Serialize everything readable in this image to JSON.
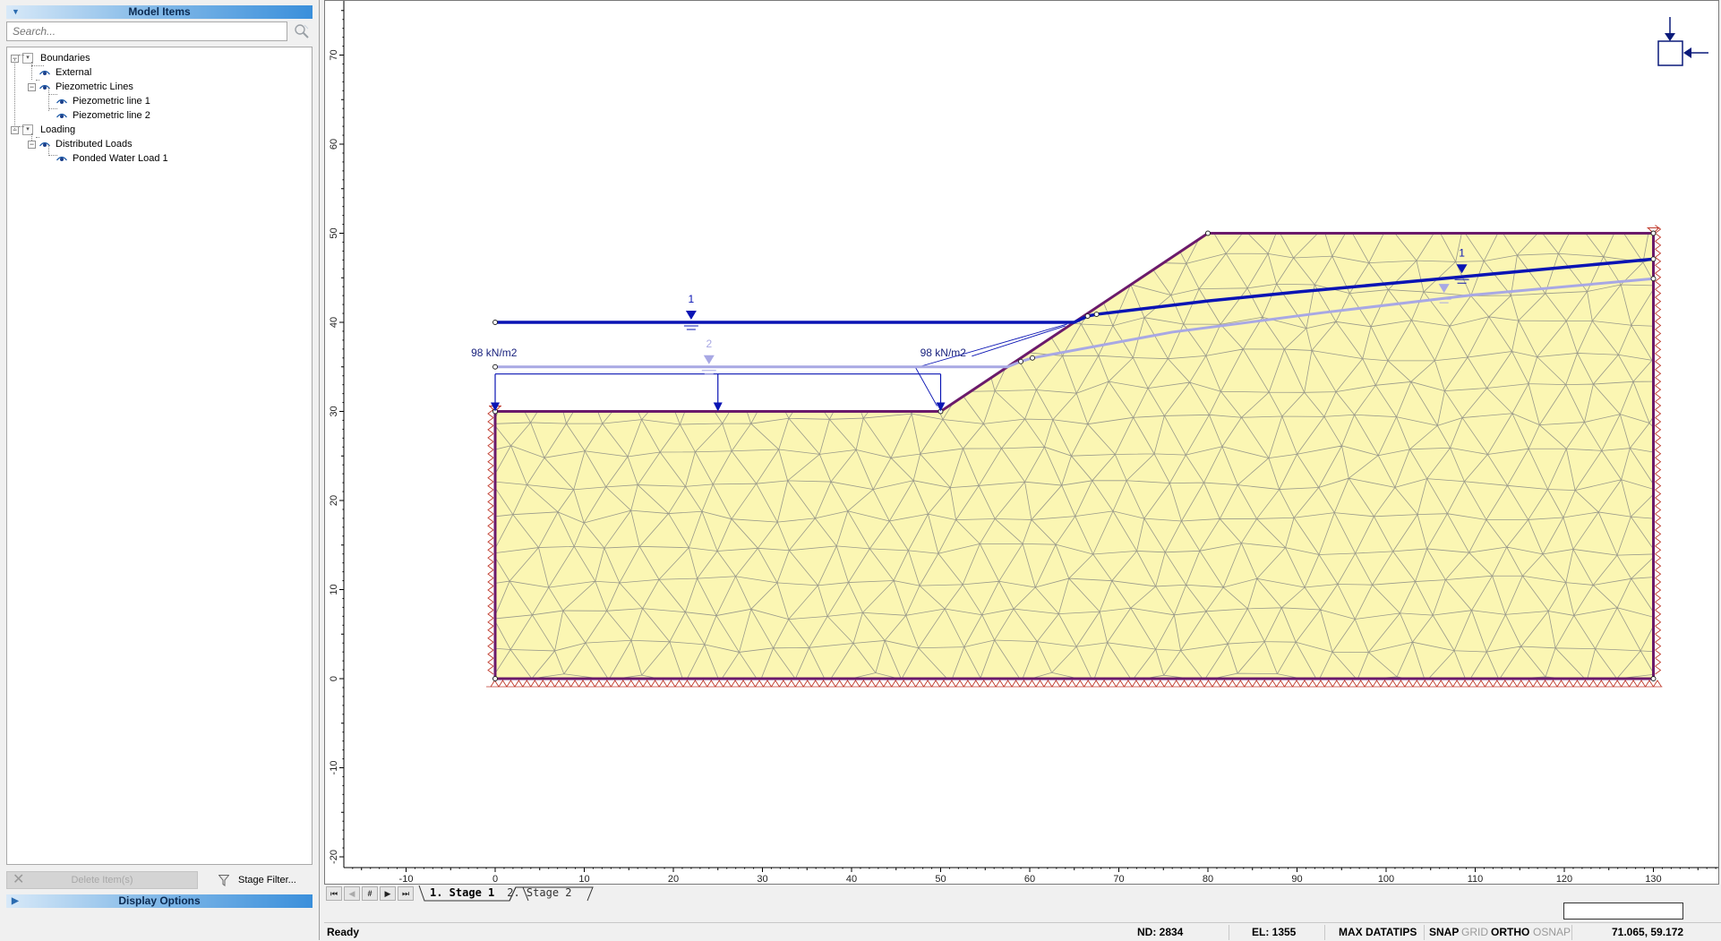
{
  "left_panel": {
    "model_items_title": "Model Items",
    "search_placeholder": "Search...",
    "tree": [
      {
        "label": "Boundaries",
        "level": 0,
        "type": "group"
      },
      {
        "label": "External",
        "level": 1,
        "type": "item"
      },
      {
        "label": "Piezometric Lines",
        "level": 1,
        "type": "subgroup"
      },
      {
        "label": "Piezometric line 1",
        "level": 2,
        "type": "item"
      },
      {
        "label": "Piezometric line 2",
        "level": 2,
        "type": "item"
      },
      {
        "label": "Loading",
        "level": 0,
        "type": "group"
      },
      {
        "label": "Distributed Loads",
        "level": 1,
        "type": "subgroup"
      },
      {
        "label": "Ponded Water Load 1",
        "level": 2,
        "type": "item"
      }
    ],
    "delete_label": "Delete Item(s)",
    "stage_filter_label": "Stage Filter...",
    "display_options_title": "Display Options"
  },
  "canvas": {
    "x_ticks": [
      -10,
      0,
      10,
      20,
      30,
      40,
      50,
      60,
      70,
      80,
      90,
      100,
      110,
      120,
      130
    ],
    "y_ticks": [
      70,
      60,
      50,
      40,
      30,
      20,
      10,
      0,
      -10,
      -20
    ],
    "model_boundary": [
      [
        0,
        0
      ],
      [
        130,
        0
      ],
      [
        130,
        50
      ],
      [
        80,
        50
      ],
      [
        50,
        30
      ],
      [
        0,
        30
      ]
    ],
    "piezometric_lines": [
      {
        "id": "1",
        "label": "1",
        "color": "#0a14b4",
        "points": [
          [
            0,
            40
          ],
          [
            65,
            40
          ],
          [
            66.5,
            40.7
          ],
          [
            67.5,
            40.9
          ],
          [
            80,
            42.4
          ],
          [
            90,
            43.4
          ],
          [
            130,
            47.1
          ]
        ],
        "marker_x": 22
      },
      {
        "id": "2",
        "label": "2",
        "color": "#a8a8e4",
        "points": [
          [
            0,
            35
          ],
          [
            57.5,
            35
          ],
          [
            59,
            35.6
          ],
          [
            60.3,
            36
          ],
          [
            76,
            38.9
          ],
          [
            93,
            41.1
          ],
          [
            110,
            43.1
          ],
          [
            130,
            44.9
          ]
        ],
        "marker_x": 24
      }
    ],
    "load_label": "98 kN/m2",
    "load_value": 98,
    "load_unit": "kN/m2",
    "soil_color": "#fbf6b3",
    "boundary_color": "#6b1a6b",
    "restraint_color": "#c0392b"
  },
  "stages": {
    "nav_buttons": [
      "first",
      "prev",
      "#",
      "next",
      "last"
    ],
    "tabs": [
      {
        "label": "1. Stage 1",
        "active": true
      },
      {
        "label": "2. Stage 2",
        "active": false
      }
    ]
  },
  "status": {
    "ready": "Ready",
    "nd": "ND: 2834",
    "el": "EL: 1355",
    "max_datatips": "MAX DATATIPS",
    "snap": "SNAP",
    "grid": "GRID",
    "ortho": "ORTHO",
    "osnap": "OSNAP",
    "coords": "71.065, 59.172"
  }
}
